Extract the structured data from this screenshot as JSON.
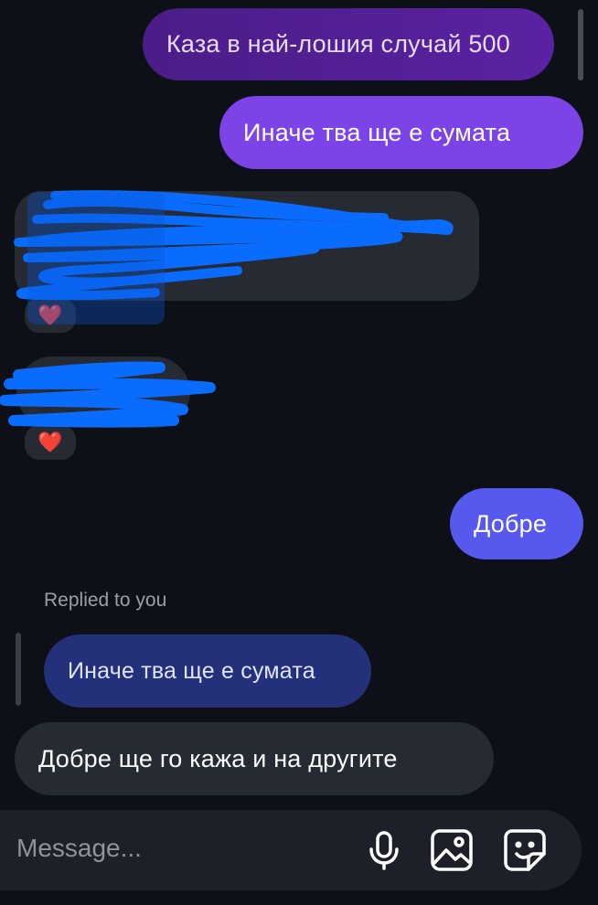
{
  "messages": {
    "m1": "Каза в най-лошия случай 500",
    "m2": "Иначе тва ще е сумата",
    "m3": "",
    "m4": "",
    "m5": "Добре",
    "reply_label": "Replied to you",
    "reply_quote": "Иначе тва ще е сумата",
    "m6": "Добре ще го кажа и на другите"
  },
  "reactions": {
    "r1": "❤️",
    "r2": "❤️"
  },
  "composer": {
    "placeholder": "Message..."
  },
  "icons": {
    "mic": "microphone-icon",
    "gallery": "image-icon",
    "sticker": "sticker-icon"
  },
  "colors": {
    "background": "#0d1017",
    "outgoing_purple": "#7c43e6",
    "outgoing_blue": "#5658ee",
    "incoming": "#262a33"
  }
}
